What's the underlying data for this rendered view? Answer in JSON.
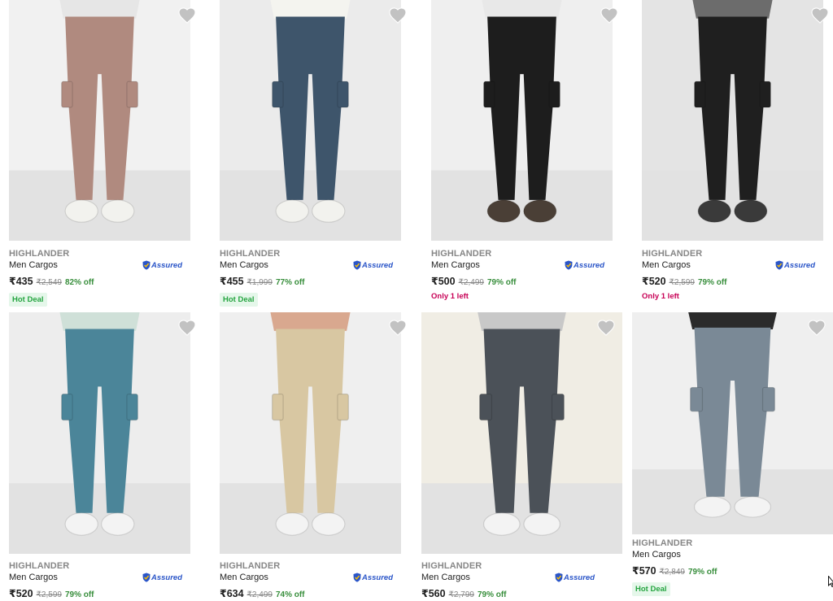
{
  "products": [
    {
      "brand": "HIGHLANDER",
      "title": "Men Cargos",
      "price": "₹435",
      "mrp": "₹2,549",
      "discount": "82% off",
      "assured": "Assured",
      "tag": "Hot Deal",
      "tag_type": "hot",
      "bg": "#f1f1f1",
      "pant_color": "#b08a7f",
      "shoe_color": "#f2f2ee",
      "top_color": "#e6e6e6"
    },
    {
      "brand": "HIGHLANDER",
      "title": "Men Cargos",
      "price": "₹455",
      "mrp": "₹1,999",
      "discount": "77% off",
      "assured": "Assured",
      "tag": "Hot Deal",
      "tag_type": "hot",
      "bg": "#ebebeb",
      "pant_color": "#3e556b",
      "shoe_color": "#f2f2ee",
      "top_color": "#f4f4ef"
    },
    {
      "brand": "HIGHLANDER",
      "title": "Men Cargos",
      "price": "₹500",
      "mrp": "₹2,499",
      "discount": "79% off",
      "assured": "Assured",
      "tag": "Only 1 left",
      "tag_type": "left",
      "bg": "#efefef",
      "pant_color": "#1d1d1d",
      "shoe_color": "#4a3f36",
      "top_color": "#e8e8e8"
    },
    {
      "brand": "HIGHLANDER",
      "title": "Men Cargos",
      "price": "₹520",
      "mrp": "₹2,599",
      "discount": "79% off",
      "assured": "Assured",
      "tag": "Only 1 left",
      "tag_type": "left",
      "bg": "#e4e4e4",
      "pant_color": "#1f1f1f",
      "shoe_color": "#3a3a3a",
      "top_color": "#6c6c6c"
    },
    {
      "brand": "HIGHLANDER",
      "title": "Men Cargos",
      "price": "₹520",
      "mrp": "₹2,599",
      "discount": "79% off",
      "assured": "Assured",
      "tag": "",
      "tag_type": "",
      "bg": "#ededed",
      "pant_color": "#4b8599",
      "shoe_color": "#f3f3f3",
      "top_color": "#cfe0d8"
    },
    {
      "brand": "HIGHLANDER",
      "title": "Men Cargos",
      "price": "₹634",
      "mrp": "₹2,499",
      "discount": "74% off",
      "assured": "Assured",
      "tag": "",
      "tag_type": "",
      "bg": "#efefef",
      "pant_color": "#d8c7a2",
      "shoe_color": "#f3f3f3",
      "top_color": "#d9a88f"
    },
    {
      "brand": "HIGHLANDER",
      "title": "Men Cargos",
      "price": "₹560",
      "mrp": "₹2,799",
      "discount": "79% off",
      "assured": "Assured",
      "tag": "",
      "tag_type": "",
      "bg": "#f0ede4",
      "pant_color": "#4b5158",
      "shoe_color": "#f3f3f3",
      "top_color": "#c8c8c8"
    },
    {
      "brand": "HIGHLANDER",
      "title": "Men Cargos",
      "price": "₹570",
      "mrp": "₹2,849",
      "discount": "79% off",
      "assured": "",
      "tag": "Hot Deal",
      "tag_type": "hot",
      "bg": "#efefef",
      "pant_color": "#7a8996",
      "shoe_color": "#f3f3f3",
      "top_color": "#2b2b2b"
    }
  ],
  "icons": {
    "wishlist": "heart-icon",
    "assured": "shield-icon"
  },
  "colors": {
    "price_discount": "#388e3c",
    "hot_deal": "#26a541",
    "only_left": "#c70055",
    "assured": "#2a55c8"
  }
}
